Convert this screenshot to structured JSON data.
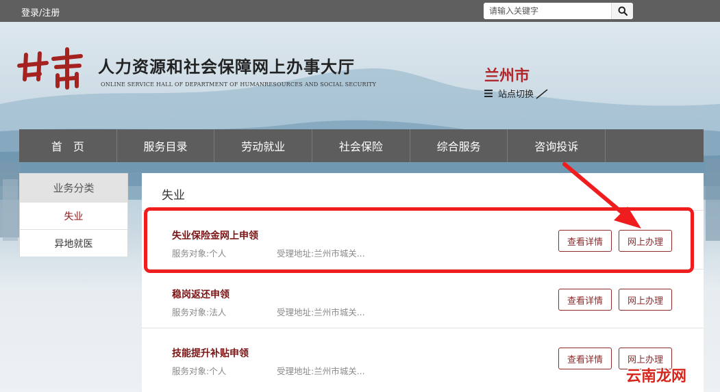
{
  "topbar": {
    "login_label": "登录/注册",
    "search_placeholder": "请输入关键字"
  },
  "header": {
    "logo_text": "甘肃",
    "title": "人力资源和社会保障网上办事大厅",
    "subtitle": "ONLINE SERVICE HALL OF DEPARTMENT OF HUMANRESOURCES AND SOCIAL SECURITY",
    "city": "兰州市",
    "switch_label": "站点切换"
  },
  "nav": {
    "items": [
      "首　页",
      "服务目录",
      "劳动就业",
      "社会保险",
      "综合服务",
      "咨询投诉"
    ]
  },
  "sidebar": {
    "heading": "业务分类",
    "items": [
      "失业",
      "异地就医"
    ],
    "active": "失业"
  },
  "main": {
    "title": "失业",
    "items": [
      {
        "title": "失业保险金网上申领",
        "target": "服务对象:个人",
        "address": "受理地址:兰州市城关...",
        "detail_label": "查看详情",
        "online_label": "网上办理"
      },
      {
        "title": "稳岗返还申领",
        "target": "服务对象:法人",
        "address": "受理地址:兰州市城关...",
        "detail_label": "查看详情",
        "online_label": "网上办理"
      },
      {
        "title": "技能提升补贴申领",
        "target": "服务对象:个人",
        "address": "受理地址:兰州市城关...",
        "detail_label": "查看详情",
        "online_label": "网上办理"
      }
    ]
  },
  "watermark": "云南龙网",
  "colors": {
    "topbar": "#5f5f5f",
    "nav": "#5d5d5d",
    "accent": "#7b1414",
    "city": "#b0262a",
    "highlight": "#ef1d1d"
  }
}
